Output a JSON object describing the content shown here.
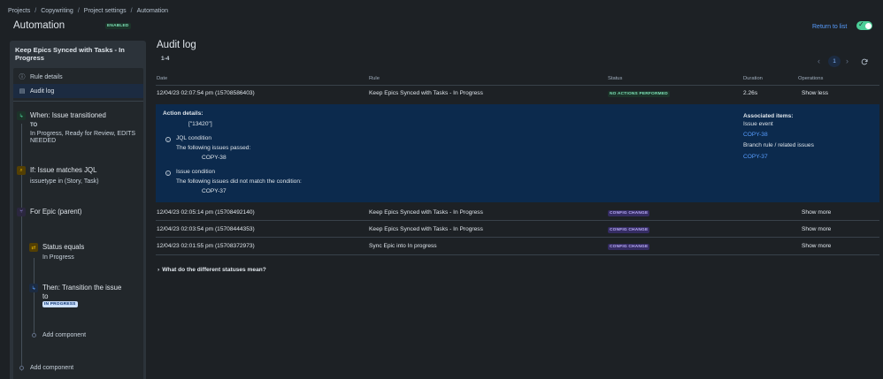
{
  "breadcrumb": [
    "Projects",
    "Copywriting",
    "Project settings",
    "Automation"
  ],
  "header": {
    "title": "Automation",
    "status": "ENABLED",
    "return_label": "Return to list"
  },
  "sidebar": {
    "rule_title": "Keep Epics Synced with Tasks - In Progress",
    "menu": [
      {
        "label": "Rule details",
        "icon": "info-icon"
      },
      {
        "label": "Audit log",
        "icon": "document-icon"
      }
    ],
    "steps": {
      "trigger": {
        "title": "When: Issue transitioned",
        "to_label": "TO",
        "to_value": "In Progress, Ready for Review, EDITS",
        "to_value2": "NEEDED"
      },
      "condition": {
        "title": "If: Issue matches JQL",
        "value": "issuetype in (Story, Task)"
      },
      "branch": {
        "title": "For Epic (parent)"
      },
      "sub_condition": {
        "title": "Status equals",
        "value": "In Progress"
      },
      "action": {
        "title": "Then: Transition the issue",
        "title2": "to",
        "badge": "IN PROGRESS"
      },
      "add_inner": "Add component",
      "add_outer": "Add component"
    }
  },
  "audit": {
    "title": "Audit log",
    "range": "1-4",
    "page": "1",
    "columns": {
      "date": "Date",
      "rule": "Rule",
      "status": "Status",
      "duration": "Duration",
      "operations": "Operations"
    },
    "rows": [
      {
        "date": "12/04/23 02:07:54 pm (15708586403)",
        "rule": "Keep Epics Synced with Tasks - In Progress",
        "status": "NO ACTIONS PERFORMED",
        "duration": "2.26s",
        "op": "Show less"
      },
      {
        "date": "12/04/23 02:05:14 pm (15708492140)",
        "rule": "Keep Epics Synced with Tasks - In Progress",
        "status": "CONFIG CHANGE",
        "duration": "",
        "op": "Show more"
      },
      {
        "date": "12/04/23 02:03:54 pm (15708444353)",
        "rule": "Keep Epics Synced with Tasks - In Progress",
        "status": "CONFIG CHANGE",
        "duration": "",
        "op": "Show more"
      },
      {
        "date": "12/04/23 02:01:55 pm (15708372973)",
        "rule": "Sync Epic into In progress",
        "status": "CONFIG CHANGE",
        "duration": "",
        "op": "Show more"
      }
    ],
    "details": {
      "heading": "Action details:",
      "value": "[\"13420\"]",
      "jql_title": "JQL condition",
      "jql_text": "The following issues passed:",
      "jql_issue": "COPY-38",
      "issue_title": "Issue condition",
      "issue_text": "The following issues did not match the condition:",
      "issue_issue": "COPY-37",
      "assoc_heading": "Associated items:",
      "assoc_event": "Issue event",
      "assoc_link1": "COPY-38",
      "assoc_branch": "Branch rule / related issues",
      "assoc_link2": "COPY-37"
    },
    "faq": "What do the different statuses mean?"
  },
  "colors": {
    "background": "#1d2125",
    "link": "#579dff",
    "toggle": "#4bce97",
    "expanded": "#0c2a4d"
  }
}
